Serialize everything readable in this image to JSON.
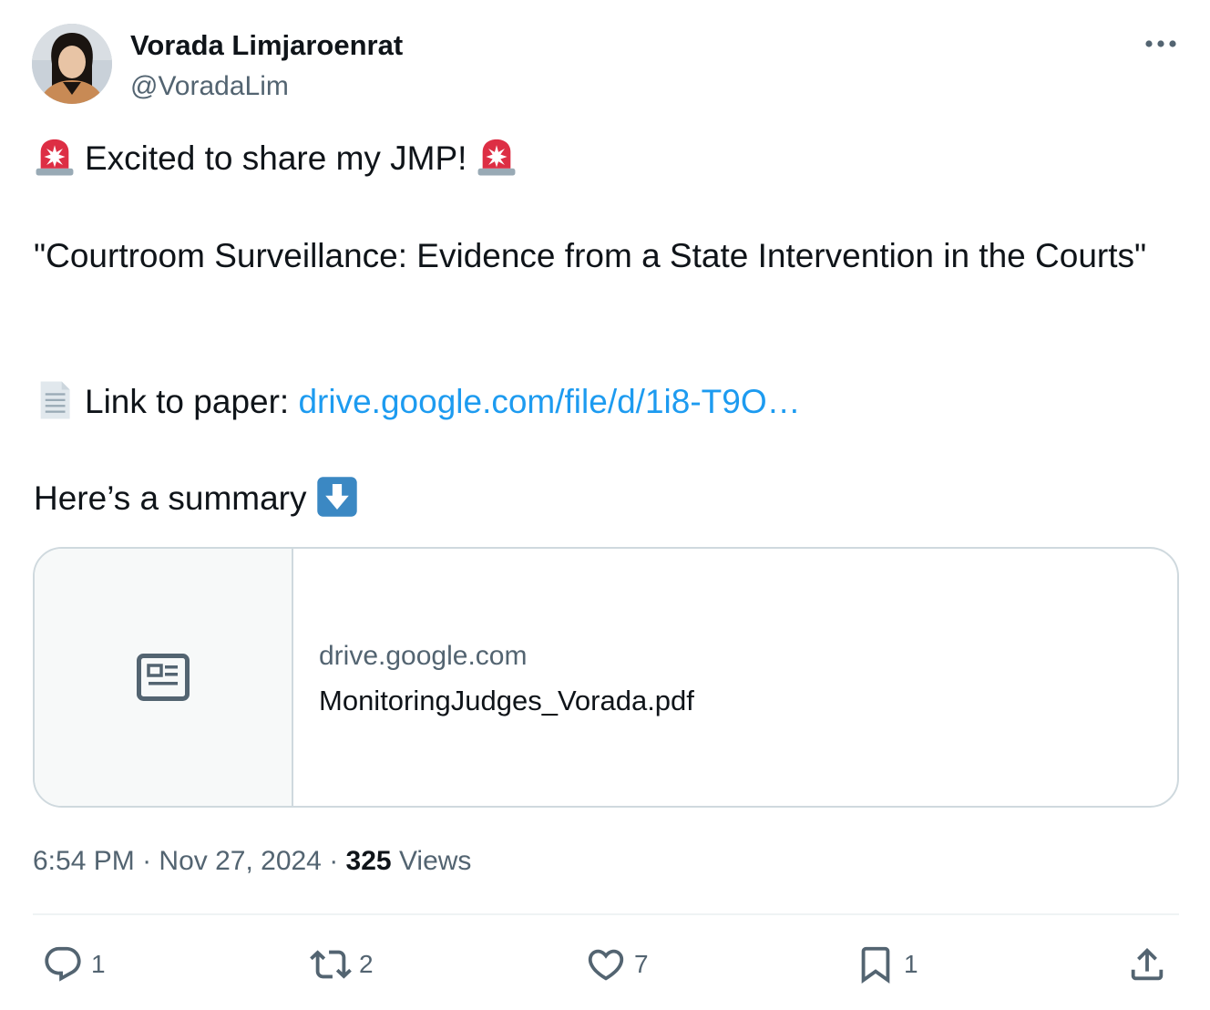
{
  "author": {
    "name": "Vorada Limjaroenrat",
    "handle": "@VoradaLim"
  },
  "icons": {
    "more": "more-horizontal-icon",
    "siren": "police-siren-emoji",
    "page": "page-facing-up-emoji",
    "down_arrow": "down-arrow-emoji",
    "article": "article-icon",
    "reply": "reply-icon",
    "retweet": "retweet-icon",
    "like": "heart-icon",
    "bookmark": "bookmark-icon",
    "share": "share-icon"
  },
  "tweet": {
    "line1": "Excited to share my JMP!",
    "line2": "\"Courtroom Surveillance: Evidence from a State Intervention in the Courts\"",
    "link_prefix": "Link to paper: ",
    "link_text": "drive.google.com/file/d/1i8-T9O…",
    "line4": "Here’s a summary"
  },
  "card": {
    "domain": "drive.google.com",
    "title": "MonitoringJudges_Vorada.pdf"
  },
  "meta": {
    "time": "6:54 PM",
    "date": "Nov 27, 2024",
    "sep": " · ",
    "views_count": "325",
    "views_label": " Views"
  },
  "actions": {
    "replies": "1",
    "reposts": "2",
    "likes": "7",
    "bookmarks": "1"
  },
  "colors": {
    "link": "#1d9bf0",
    "secondary_text": "#536471",
    "border": "#cfd9de",
    "siren_red": "#dd2e44",
    "arrow_blue": "#3b88c3"
  }
}
